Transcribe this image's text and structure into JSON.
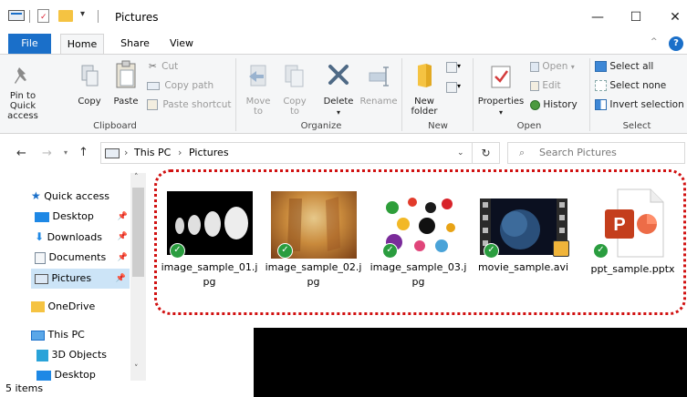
{
  "window": {
    "title": "Pictures",
    "minimize": "—",
    "maximize": "☐",
    "close": "✕"
  },
  "tabs": {
    "file": "File",
    "home": "Home",
    "share": "Share",
    "view": "View"
  },
  "ribbon": {
    "clipboard": {
      "group": "Clipboard",
      "pin_quick_access": "Pin to Quick access",
      "copy": "Copy",
      "paste": "Paste",
      "cut": "Cut",
      "copy_path": "Copy path",
      "paste_shortcut": "Paste shortcut"
    },
    "organize": {
      "group": "Organize",
      "move_to": "Move to",
      "copy_to": "Copy to",
      "delete": "Delete",
      "rename": "Rename"
    },
    "new": {
      "group": "New",
      "new_folder": "New folder"
    },
    "open": {
      "group": "Open",
      "properties": "Properties",
      "open": "Open",
      "edit": "Edit",
      "history": "History"
    },
    "select": {
      "group": "Select",
      "select_all": "Select all",
      "select_none": "Select none",
      "invert_selection": "Invert selection"
    }
  },
  "address": {
    "crumb_this_pc": "This PC",
    "crumb_pictures": "Pictures",
    "search_placeholder": "Search Pictures"
  },
  "nav": {
    "quick_access": "Quick access",
    "desktop": "Desktop",
    "downloads": "Downloads",
    "documents": "Documents",
    "pictures": "Pictures",
    "onedrive": "OneDrive",
    "this_pc": "This PC",
    "objects_3d": "3D Objects",
    "desktop2": "Desktop"
  },
  "files": [
    {
      "name": "image_sample_01.jpg"
    },
    {
      "name": "image_sample_02.jpg"
    },
    {
      "name": "image_sample_03.jpg"
    },
    {
      "name": "movie_sample.avi"
    },
    {
      "name": "ppt_sample.pptx"
    }
  ],
  "status": {
    "item_count": "5 items"
  },
  "colors": {
    "accent": "#1a6fc9",
    "selected": "#cce4f7",
    "highlight_border": "#d11111",
    "sync_check": "#2a9d3f"
  }
}
